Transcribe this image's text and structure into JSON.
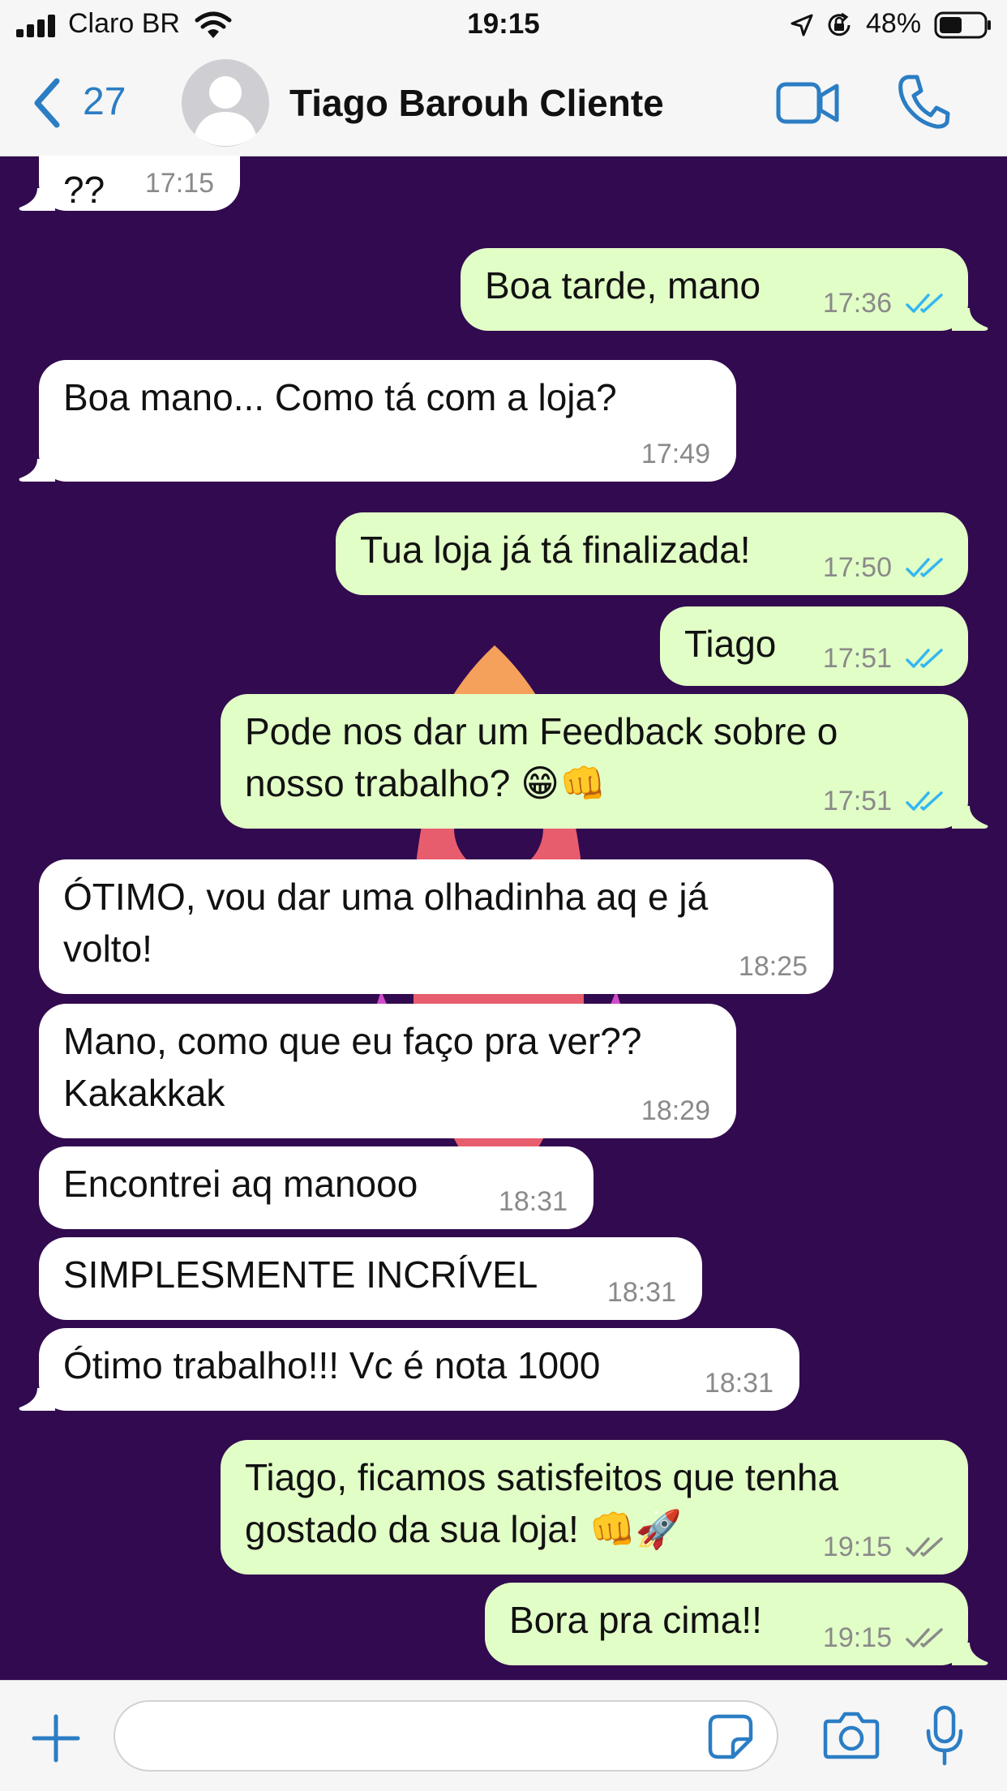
{
  "status_bar": {
    "carrier": "Claro BR",
    "time": "19:15",
    "battery": "48%"
  },
  "header": {
    "back_count": "27",
    "contact_name": "Tiago Barouh Cliente"
  },
  "messages": [
    {
      "dir": "in",
      "text": "??",
      "time": "17:15",
      "status": ""
    },
    {
      "dir": "out",
      "text": "Boa tarde, mano",
      "time": "17:36",
      "status": "read"
    },
    {
      "dir": "in",
      "text": "Boa mano... Como tá com a loja?",
      "time": "17:49",
      "status": ""
    },
    {
      "dir": "out",
      "text": "Tua loja já tá finalizada!",
      "time": "17:50",
      "status": "read"
    },
    {
      "dir": "out",
      "text": "Tiago",
      "time": "17:51",
      "status": "read"
    },
    {
      "dir": "out",
      "text": "Pode nos dar um Feedback sobre o\nnosso trabalho? 😁👊",
      "time": "17:51",
      "status": "read"
    },
    {
      "dir": "in",
      "text": "ÓTIMO, vou dar uma olhadinha aq e já\nvolto!",
      "time": "18:25",
      "status": ""
    },
    {
      "dir": "in",
      "text": "Mano, como que eu faço pra ver??\nKakakkak",
      "time": "18:29",
      "status": ""
    },
    {
      "dir": "in",
      "text": "Encontrei aq manooo",
      "time": "18:31",
      "status": ""
    },
    {
      "dir": "in",
      "text": "SIMPLESMENTE INCRÍVEL",
      "time": "18:31",
      "status": ""
    },
    {
      "dir": "in",
      "text": "Ótimo trabalho!!! Vc é nota 1000",
      "time": "18:31",
      "status": ""
    },
    {
      "dir": "out",
      "text": "Tiago, ficamos satisfeitos que tenha\ngostado da sua loja! 👊🚀",
      "time": "19:15",
      "status": "delivered"
    },
    {
      "dir": "out",
      "text": "Bora pra cima!!",
      "time": "19:15",
      "status": "delivered"
    }
  ],
  "colors": {
    "chat_background": "#310A4F",
    "incoming_bubble": "#FFFFFF",
    "outgoing_bubble": "#E1FEC6",
    "read_ticks": "#34B7F1",
    "delivered_ticks": "#8A8A8A",
    "accent": "#2B7DC4"
  },
  "icons": {
    "back": "chevron-left-icon",
    "avatar": "default-avatar-icon",
    "video_call": "video-camera-icon",
    "voice_call": "phone-icon",
    "attach": "plus-icon",
    "sticker": "sticker-icon",
    "camera": "camera-icon",
    "microphone": "microphone-icon"
  }
}
